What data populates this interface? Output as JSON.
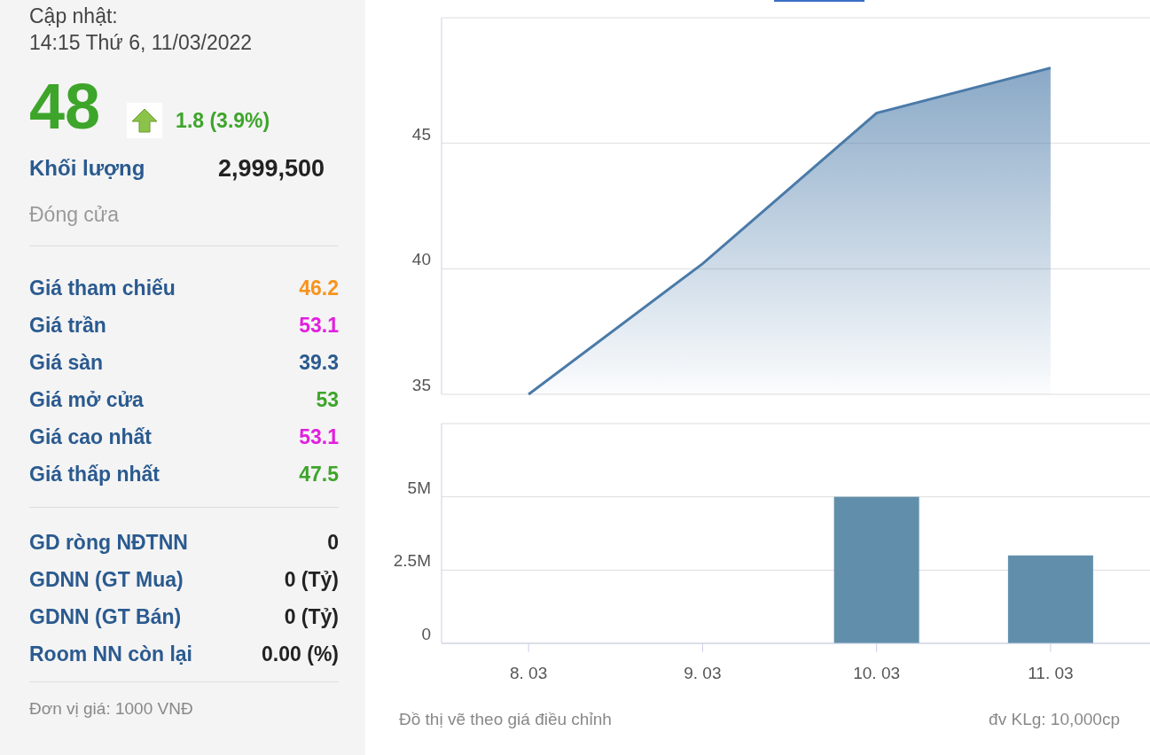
{
  "update": {
    "label": "Cập nhật:",
    "datetime": "14:15 Thứ 6, 11/03/2022"
  },
  "price": {
    "value": "48",
    "kind": "up",
    "change": "1.8 (3.9%)"
  },
  "volume": {
    "label": "Khối lượng",
    "value": "2,999,500"
  },
  "session_status": "Đóng cửa",
  "price_rows": [
    {
      "label": "Giá tham chiếu",
      "value": "46.2",
      "color": "#f7941d"
    },
    {
      "label": "Giá trần",
      "value": "53.1",
      "color": "#e31fe0"
    },
    {
      "label": "Giá sàn",
      "value": "39.3",
      "color": "#2a5a8f"
    },
    {
      "label": "Giá mở cửa",
      "value": "53",
      "color": "#3ea52b"
    },
    {
      "label": "Giá cao nhất",
      "value": "53.1",
      "color": "#e31fe0"
    },
    {
      "label": "Giá thấp nhất",
      "value": "47.5",
      "color": "#3ea52b"
    }
  ],
  "foreign_rows": [
    {
      "label": "GD ròng NĐTNN",
      "value": "0"
    },
    {
      "label": "GDNN (GT Mua)",
      "value": "0 (Tỷ)"
    },
    {
      "label": "GDNN (GT Bán)",
      "value": "0 (Tỷ)"
    },
    {
      "label": "Room NN còn lại",
      "value": "0.00 (%)"
    }
  ],
  "unit_note": "Đơn vị giá: 1000 VNĐ",
  "price_chart": {
    "chart_data": {
      "type": "area",
      "series": [
        {
          "color": "#4a7aa8",
          "values": [
            35,
            40.2,
            46.2,
            48
          ]
        }
      ],
      "ylim": [
        35,
        50
      ],
      "yticks": [
        35,
        40,
        45
      ]
    }
  },
  "volume_chart": {
    "chart_data": {
      "type": "bar",
      "categories": [
        "8. 03",
        "9. 03",
        "10. 03",
        "11. 03"
      ],
      "series": [
        {
          "color": "#618fab",
          "values": [
            0,
            0,
            5000000,
            3000000
          ]
        }
      ],
      "ylim": [
        0,
        7500000
      ],
      "yticks": [
        {
          "value": 0,
          "label": "0"
        },
        {
          "value": 2500000,
          "label": "2.5M"
        },
        {
          "value": 5000000,
          "label": "5M"
        }
      ]
    }
  },
  "footer": {
    "note": "Đồ thị vẽ theo giá điều chỉnh",
    "volume_unit": "đv KLg: 10,000cp"
  }
}
